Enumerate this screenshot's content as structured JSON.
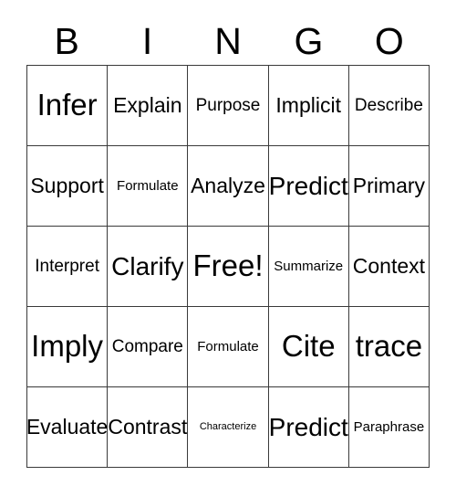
{
  "card": {
    "title": "BINGO",
    "header_letters": [
      "B",
      "I",
      "N",
      "G",
      "O"
    ],
    "rows": [
      [
        {
          "label": "Infer",
          "size": "fs-xxl"
        },
        {
          "label": "Explain",
          "size": "fs-lg"
        },
        {
          "label": "Purpose",
          "size": "fs-md"
        },
        {
          "label": "Implicit",
          "size": "fs-lg"
        },
        {
          "label": "Describe",
          "size": "fs-md"
        }
      ],
      [
        {
          "label": "Support",
          "size": "fs-lg"
        },
        {
          "label": "Formulate",
          "size": "fs-sm"
        },
        {
          "label": "Analyze",
          "size": "fs-lg"
        },
        {
          "label": "Predict",
          "size": "fs-xl"
        },
        {
          "label": "Primary",
          "size": "fs-lg"
        }
      ],
      [
        {
          "label": "Interpret",
          "size": "fs-md"
        },
        {
          "label": "Clarify",
          "size": "fs-xl"
        },
        {
          "label": "Free!",
          "size": "fs-xxl"
        },
        {
          "label": "Summarize",
          "size": "fs-sm"
        },
        {
          "label": "Context",
          "size": "fs-lg"
        }
      ],
      [
        {
          "label": "Imply",
          "size": "fs-xxl"
        },
        {
          "label": "Compare",
          "size": "fs-md"
        },
        {
          "label": "Formulate",
          "size": "fs-sm"
        },
        {
          "label": "Cite",
          "size": "fs-xxl"
        },
        {
          "label": "trace",
          "size": "fs-xxl"
        }
      ],
      [
        {
          "label": "Evaluate",
          "size": "fs-lg"
        },
        {
          "label": "Contrast",
          "size": "fs-lg"
        },
        {
          "label": "Characterize",
          "size": "fs-xxs"
        },
        {
          "label": "Predict",
          "size": "fs-xl"
        },
        {
          "label": "Paraphrase",
          "size": "fs-sm"
        }
      ]
    ]
  },
  "colors": {
    "background": "#ffffff",
    "border": "#3a3a3a",
    "text": "#000000"
  }
}
